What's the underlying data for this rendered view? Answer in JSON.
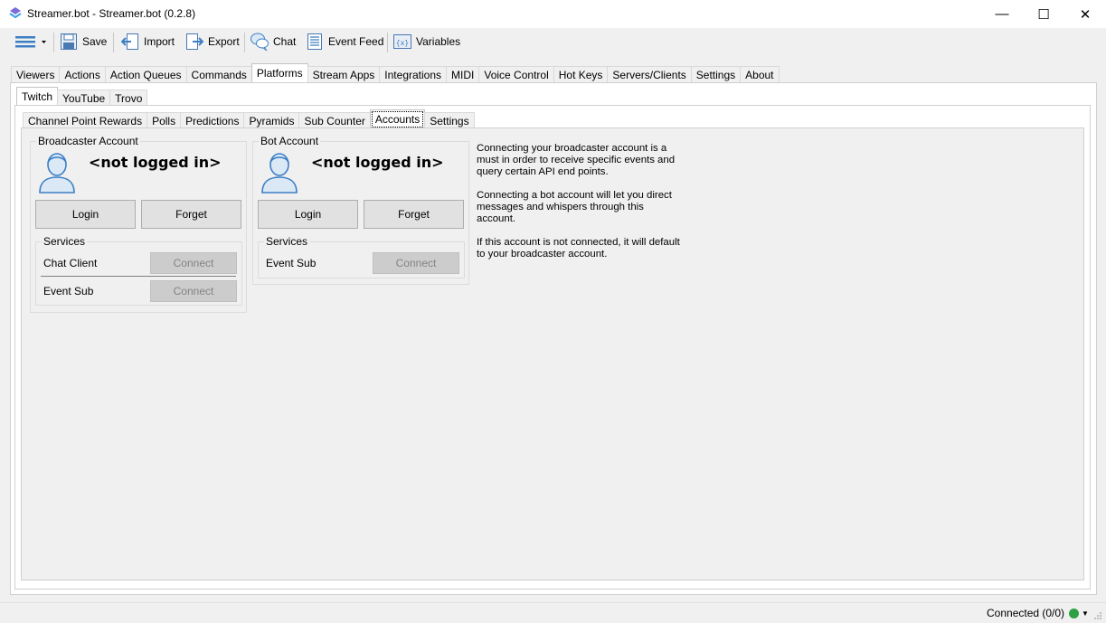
{
  "window": {
    "title": "Streamer.bot - Streamer.bot (0.2.8)",
    "controls": {
      "minimize": "—",
      "maximize": "☐",
      "close": "✕"
    }
  },
  "toolbar": {
    "save": "Save",
    "import": "Import",
    "export": "Export",
    "chat": "Chat",
    "event_feed": "Event Feed",
    "variables": "Variables"
  },
  "main_tabs": [
    "Viewers",
    "Actions",
    "Action Queues",
    "Commands",
    "Platforms",
    "Stream Apps",
    "Integrations",
    "MIDI",
    "Voice Control",
    "Hot Keys",
    "Servers/Clients",
    "Settings",
    "About"
  ],
  "main_tabs_active": "Platforms",
  "platform_tabs": [
    "Twitch",
    "YouTube",
    "Trovo"
  ],
  "platform_tabs_active": "Twitch",
  "twitch_tabs": [
    "Channel Point Rewards",
    "Polls",
    "Predictions",
    "Pyramids",
    "Sub Counter",
    "Accounts",
    "Settings"
  ],
  "twitch_tabs_active": "Accounts",
  "broadcaster": {
    "group_title": "Broadcaster Account",
    "name": "<not logged in>",
    "login_label": "Login",
    "forget_label": "Forget",
    "services_title": "Services",
    "services": [
      {
        "label": "Chat Client",
        "button": "Connect"
      },
      {
        "label": "Event Sub",
        "button": "Connect"
      }
    ]
  },
  "bot": {
    "group_title": "Bot Account",
    "name": "<not logged in>",
    "login_label": "Login",
    "forget_label": "Forget",
    "services_title": "Services",
    "services": [
      {
        "label": "Event Sub",
        "button": "Connect"
      }
    ]
  },
  "info_text": "Connecting your broadcaster account is a must in order to receive specific events and query certain API end points.\n\nConnecting a bot account will let you direct messages and whispers through this account.\n\nIf this account is not connected, it will default to your broadcaster account.",
  "status": {
    "connection": "Connected (0/0)",
    "indicator_color": "#2ea043"
  },
  "colors": {
    "icon_blue": "#4a90d9",
    "avatar_fill": "#dbe9f7",
    "avatar_stroke": "#3d7fc4"
  }
}
